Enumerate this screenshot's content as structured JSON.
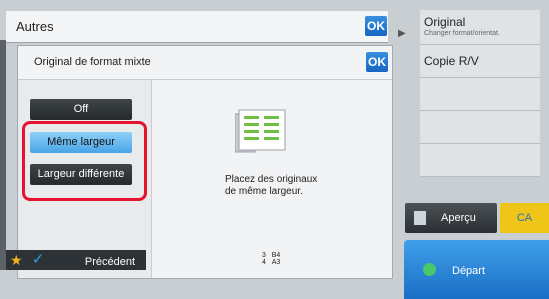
{
  "topbar": {
    "title": "Autres",
    "ok_label": "OK"
  },
  "right_panel": {
    "original_label": "Original",
    "original_sub": "Changer format/orientat.",
    "copy_label": "Copie R/V"
  },
  "dialog": {
    "title": "Original de format mixte",
    "ok_label": "OK",
    "options": [
      "Off",
      "Même largeur",
      "Largeur différente"
    ],
    "selected": "Même largeur",
    "message_line1": "Placez des originaux",
    "message_line2": "de même largeur."
  },
  "bottom": {
    "prev_label": "Précédent",
    "counter_lines": [
      {
        "n": "3",
        "size": "B4"
      },
      {
        "n": "4",
        "size": "A3"
      }
    ]
  },
  "actions": {
    "preview_label": "Aperçu",
    "ca_label": "CA",
    "start_label": "Départ"
  },
  "colors": {
    "accent_blue": "#1a6fc6",
    "selection": "#47a4e6",
    "highlight_red": "#e5132f",
    "ca_yellow": "#f0c51a"
  },
  "icons": [
    "star-icon",
    "check-icon",
    "document-icon",
    "preview-icon",
    "start-icon",
    "play-arrow-icon"
  ]
}
